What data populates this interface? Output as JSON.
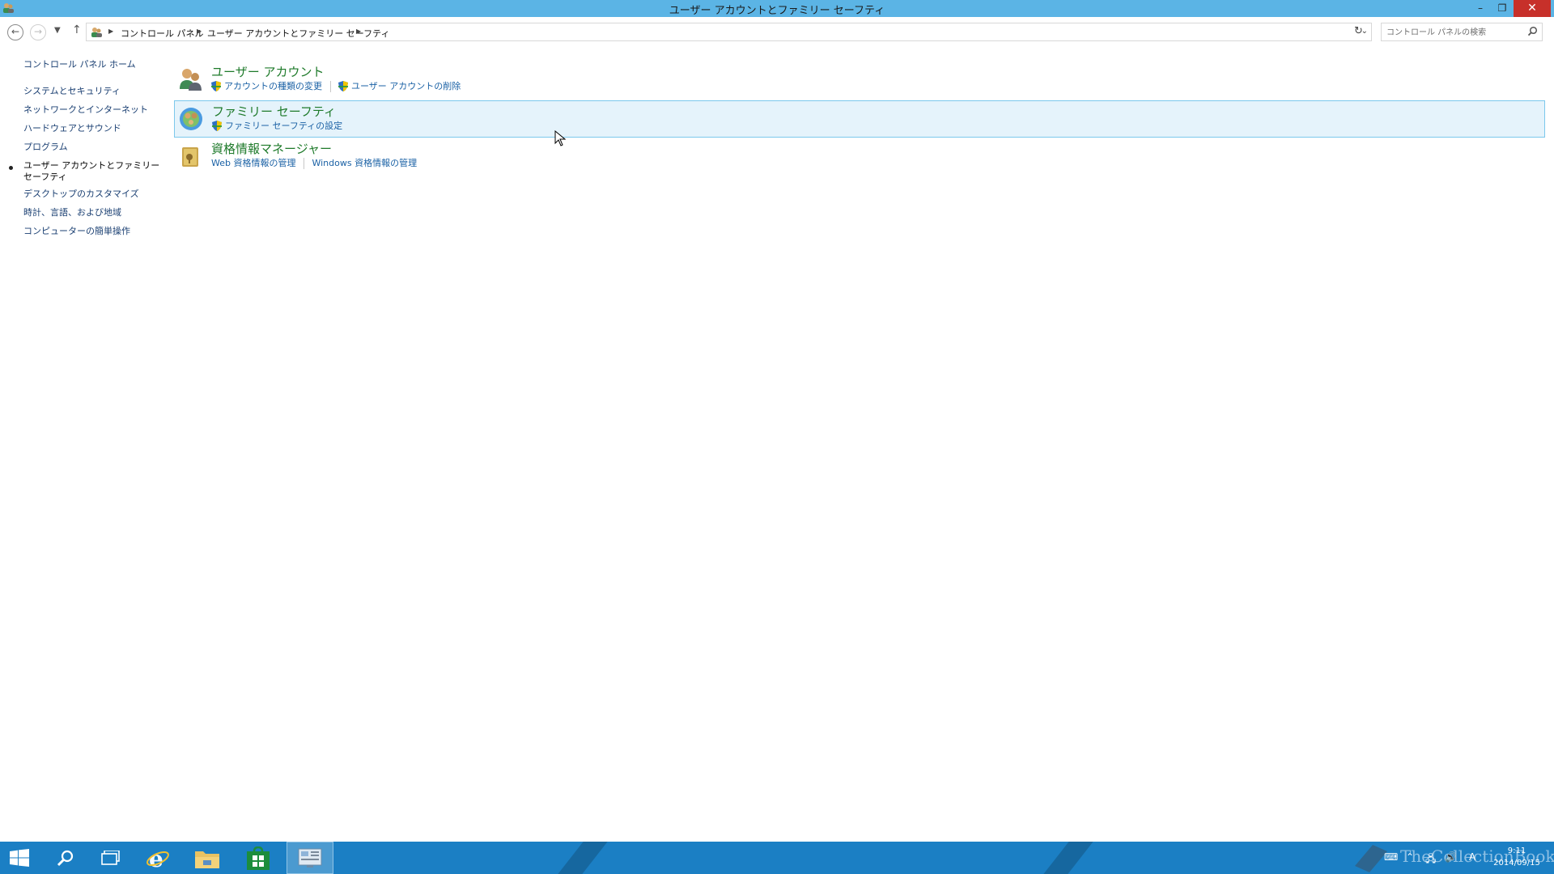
{
  "window": {
    "title": "ユーザー アカウントとファミリー セーフティ",
    "minimize_glyph": "–",
    "maximize_glyph": "❐",
    "close_glyph": "✕"
  },
  "address": {
    "crumbs": [
      "コントロール パネル",
      "ユーザー アカウントとファミリー セーフティ"
    ],
    "search_placeholder": "コントロール パネルの検索"
  },
  "sidebar": {
    "items": [
      {
        "label": "コントロール パネル ホーム"
      },
      {
        "label": "システムとセキュリティ"
      },
      {
        "label": "ネットワークとインターネット"
      },
      {
        "label": "ハードウェアとサウンド"
      },
      {
        "label": "プログラム"
      },
      {
        "label": "ユーザー アカウントとファミリー セーフティ",
        "current": true
      },
      {
        "label": "デスクトップのカスタマイズ"
      },
      {
        "label": "時計、言語、および地域"
      },
      {
        "label": "コンピューターの簡単操作"
      }
    ]
  },
  "categories": [
    {
      "title": "ユーザー アカウント",
      "links": [
        "アカウントの種類の変更",
        "ユーザー アカウントの削除"
      ]
    },
    {
      "title": "ファミリー セーフティ",
      "links": [
        "ファミリー セーフティの設定"
      ]
    },
    {
      "title": "資格情報マネージャー",
      "links": [
        "Web 資格情報の管理",
        "Windows 資格情報の管理"
      ]
    }
  ],
  "taskbar": {
    "apps": [
      "start",
      "search",
      "task-view",
      "internet-explorer",
      "file-explorer",
      "store",
      "control-panel"
    ],
    "clock_time": "9:11",
    "clock_date": "2014/09/15",
    "ime": "A",
    "watermark": "TheCollectionBook"
  },
  "colors": {
    "titlebar": "#5bb4e5",
    "taskbar": "#1b7fc4",
    "category_title": "#1e7a2a",
    "link": "#1a61a5",
    "selected_bg": "#e5f3fb"
  }
}
